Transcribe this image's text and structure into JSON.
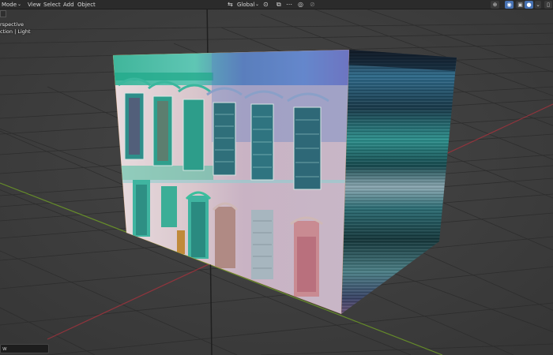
{
  "header": {
    "mode_label": "t Mode",
    "menu": [
      "View",
      "Select",
      "Add",
      "Object"
    ],
    "transform_orientation": "Global",
    "colors": {
      "bar": "#2b2b2b",
      "active": "#4772b3"
    }
  },
  "overlay": {
    "line1": "erspective",
    "line2": "ection | Light"
  },
  "status": {
    "value": "w"
  },
  "scene": {
    "object": "textured cube with building facade",
    "grid": true,
    "axes": {
      "x_color": "#a0333d",
      "y_color": "#6d9a27"
    }
  },
  "icons": [
    "chevron-down-icon",
    "transform-icon",
    "pivot-icon",
    "snap-icon",
    "proportional-icon",
    "gizmo-icon",
    "overlay-icon",
    "xray-icon",
    "shading-icon"
  ]
}
